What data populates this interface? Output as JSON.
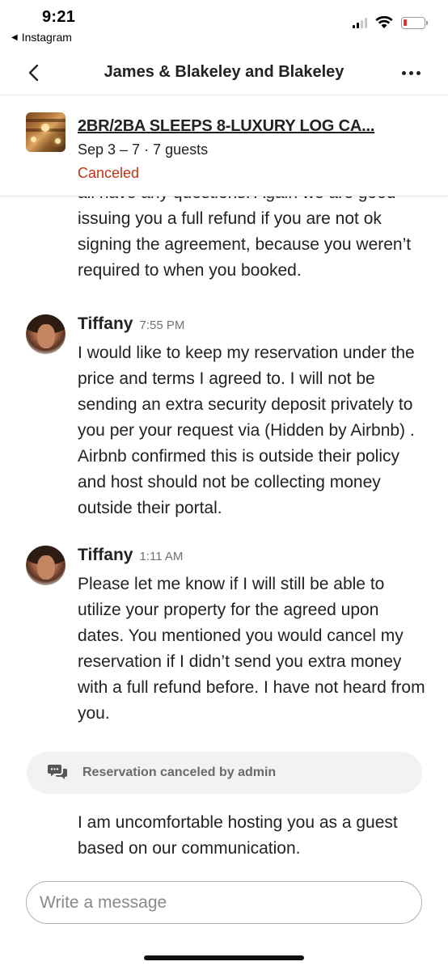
{
  "status_bar": {
    "time": "9:21",
    "back_app": "Instagram"
  },
  "header": {
    "title": "James & Blakeley and Blakeley"
  },
  "listing": {
    "title": "2BR/2BA SLEEPS 8-LUXURY LOG CA...",
    "dates": "Sep 3 – 7 · 7 guests",
    "status": "Canceled",
    "status_color": "#c13515"
  },
  "thread": {
    "continued_text": "all have any questions. Again we are good issuing you a full refund if you are not ok signing the agreement, because you weren’t required to when you booked.",
    "messages": [
      {
        "sender": "Tiffany",
        "time": "7:55 PM",
        "text": "I would like to keep my reservation under the price and terms I agreed to. I will not be sending an extra security deposit privately to you per your request via (Hidden by Airbnb) . Airbnb confirmed this is outside their policy and host should not be collecting money outside their portal."
      },
      {
        "sender": "Tiffany",
        "time": "1:11 AM",
        "text": "Please let me know if I will still be able to utilize your property for the agreed upon dates. You mentioned you would cancel my reservation if I didn’t send you extra money with a full refund before. I have not heard from you."
      }
    ],
    "system_notice": "Reservation canceled by admin",
    "host_message": "I am uncomfortable hosting you as a guest based on our communication."
  },
  "composer": {
    "placeholder": "Write a message",
    "value": ""
  },
  "icons": {
    "back": "chevron-left-icon",
    "more": "more-horizontal-icon",
    "system": "chat-bubbles-icon"
  }
}
